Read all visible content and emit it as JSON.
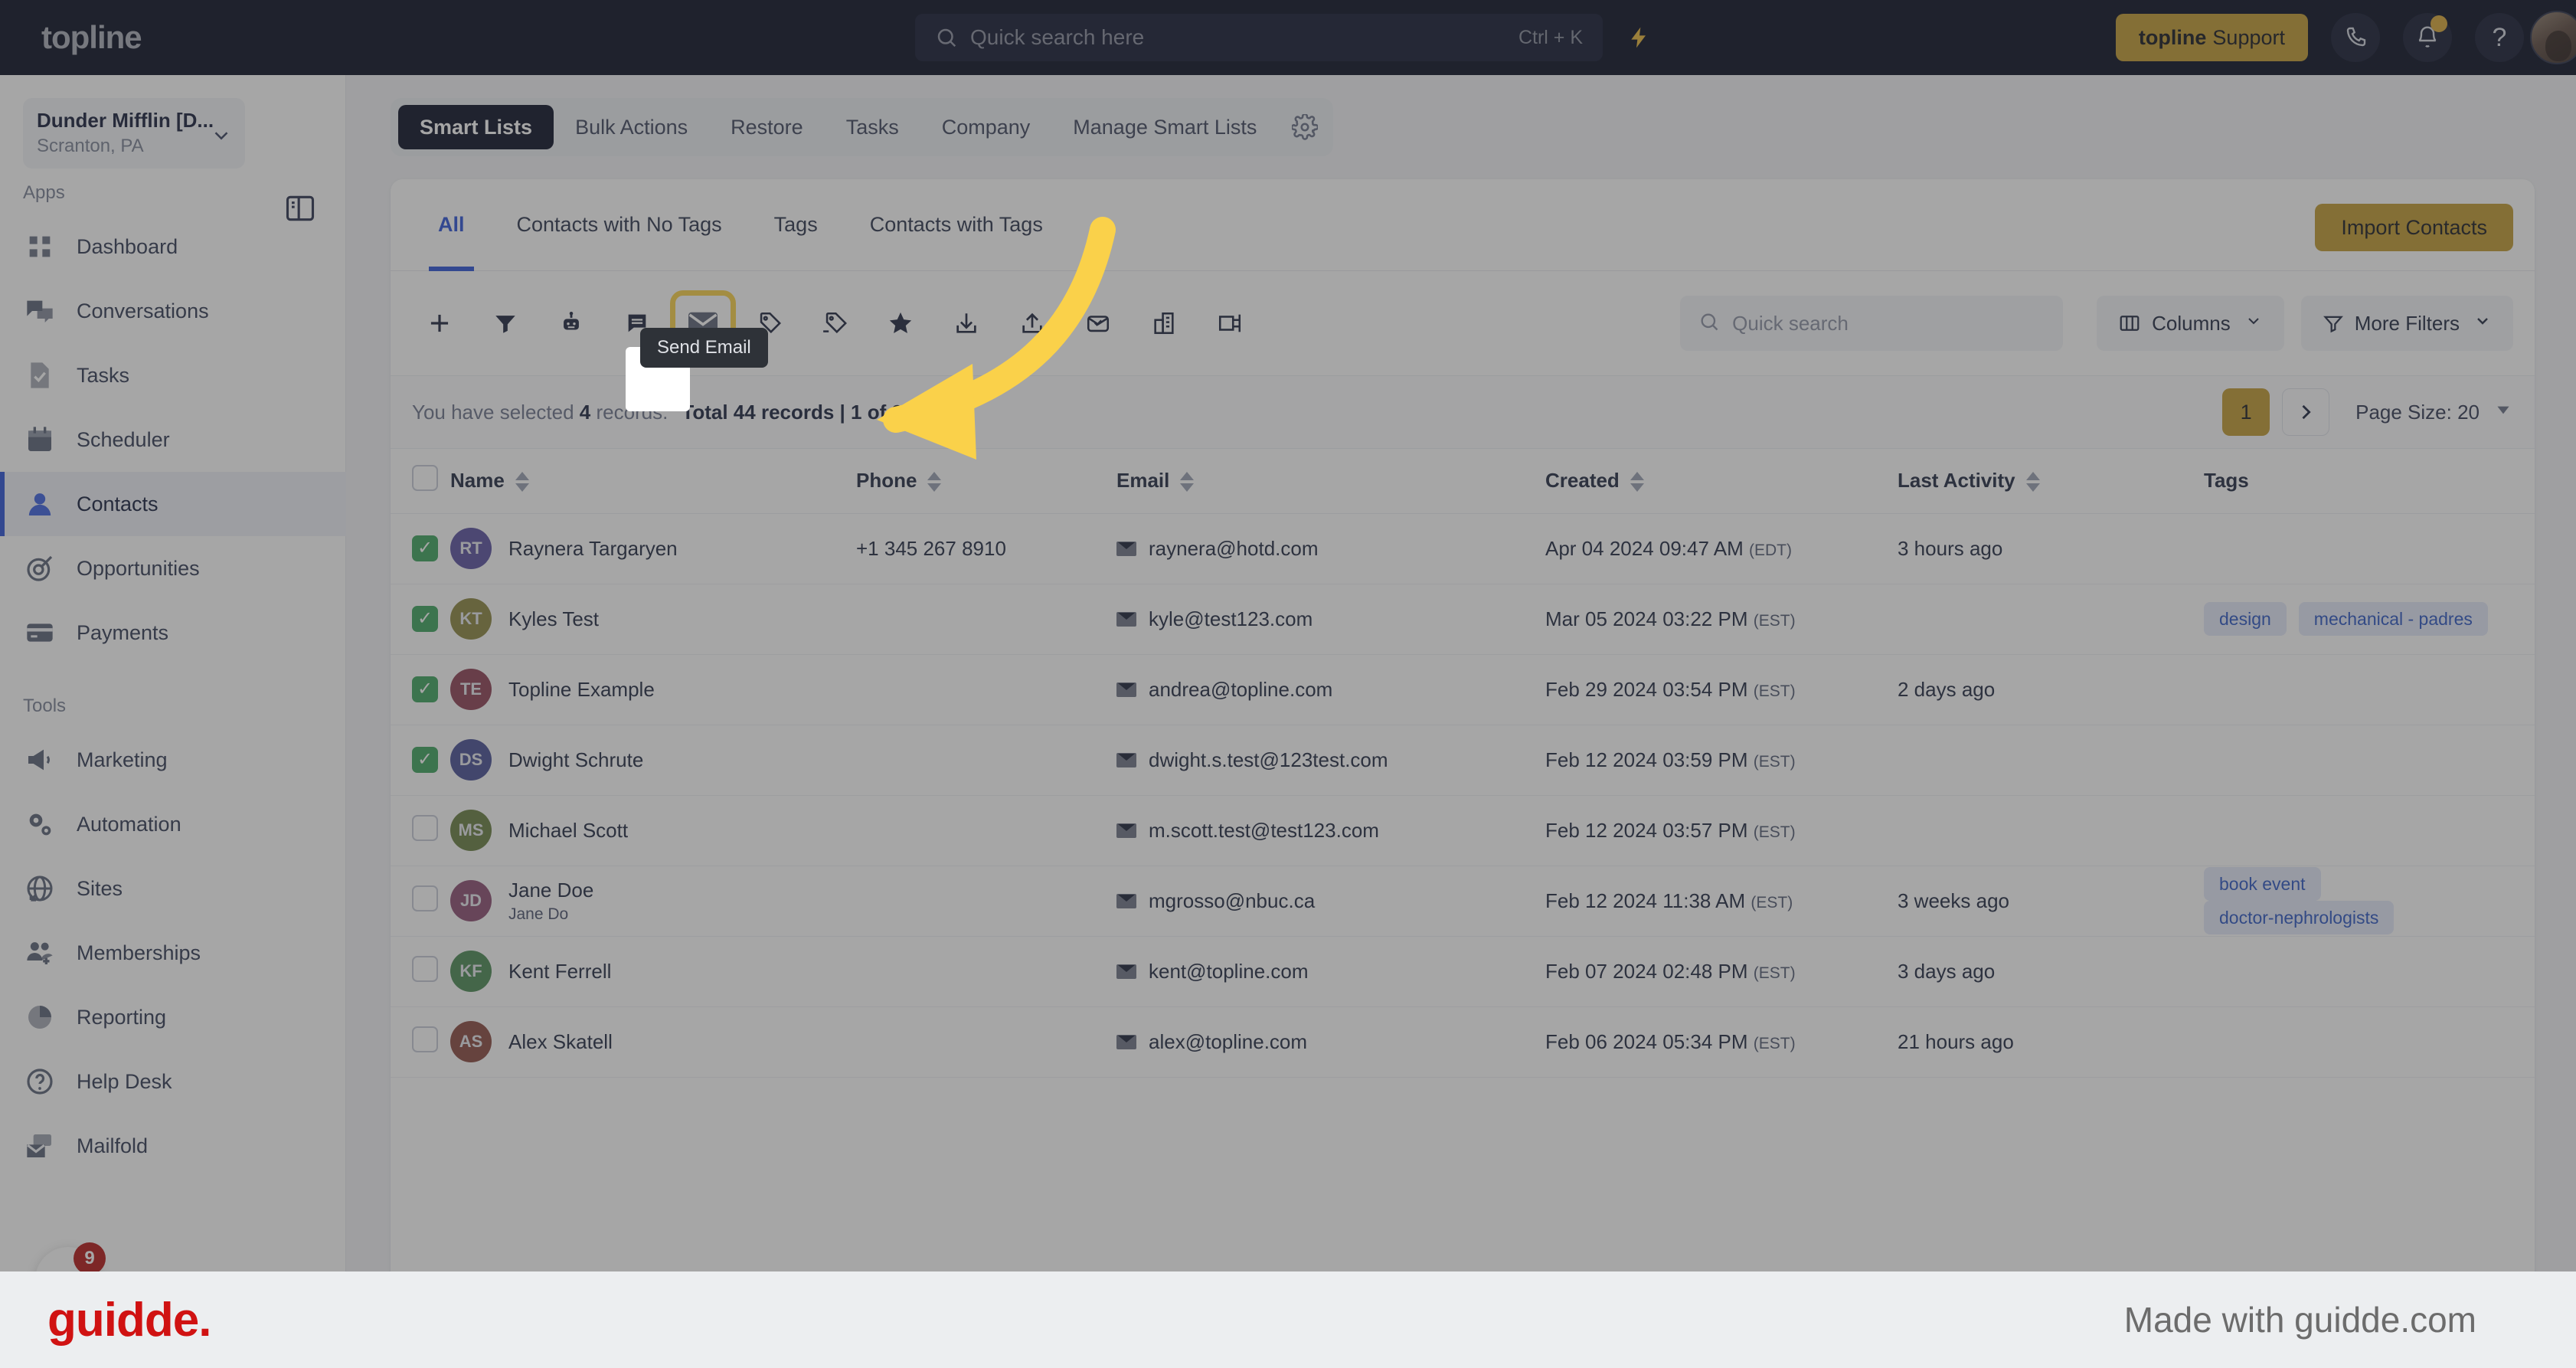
{
  "header": {
    "brand": "topline",
    "search_placeholder": "Quick search here",
    "search_shortcut": "Ctrl + K",
    "support_brand": "topline",
    "support_label": "Support",
    "icons": {
      "bolt": "⚡",
      "phone": "phone",
      "bell": "bell",
      "help": "?"
    }
  },
  "sidebar": {
    "location_name": "Dunder Mifflin [D...",
    "location_sub": "Scranton, PA",
    "sections": [
      {
        "label": "Apps",
        "items": [
          {
            "label": "Dashboard",
            "icon": "dashboard-icon",
            "active": false
          },
          {
            "label": "Conversations",
            "icon": "conversations-icon",
            "active": false
          },
          {
            "label": "Tasks",
            "icon": "tasks-icon",
            "active": false
          },
          {
            "label": "Scheduler",
            "icon": "scheduler-icon",
            "active": false
          },
          {
            "label": "Contacts",
            "icon": "contacts-icon",
            "active": true
          },
          {
            "label": "Opportunities",
            "icon": "opportunities-icon",
            "active": false
          },
          {
            "label": "Payments",
            "icon": "payments-icon",
            "active": false
          }
        ]
      },
      {
        "label": "Tools",
        "items": [
          {
            "label": "Marketing",
            "icon": "marketing-icon",
            "active": false
          },
          {
            "label": "Automation",
            "icon": "automation-icon",
            "active": false
          },
          {
            "label": "Sites",
            "icon": "sites-icon",
            "active": false
          },
          {
            "label": "Memberships",
            "icon": "memberships-icon",
            "active": false
          },
          {
            "label": "Reporting",
            "icon": "reporting-icon",
            "active": false
          },
          {
            "label": "Help Desk",
            "icon": "helpdesk-icon",
            "active": false
          },
          {
            "label": "Mailfold",
            "icon": "mailfold-icon",
            "active": false
          }
        ]
      }
    ],
    "fab_badge": "9"
  },
  "smartlists": {
    "items": [
      "Smart Lists",
      "Bulk Actions",
      "Restore",
      "Tasks",
      "Company",
      "Manage Smart Lists"
    ],
    "active": "Smart Lists"
  },
  "tabs": {
    "items": [
      "All",
      "Contacts with No Tags",
      "Tags",
      "Contacts with Tags"
    ],
    "active": "All",
    "import_label": "Import Contacts"
  },
  "toolbar": {
    "icons": [
      "add-icon",
      "filter-icon",
      "bot-icon",
      "sms-icon",
      "email-icon",
      "add-tag-icon",
      "remove-tag-icon",
      "star-icon",
      "download-icon",
      "upload-icon",
      "mail-check-icon",
      "business-icon",
      "merge-icon"
    ],
    "highlighted_icon": "email-icon",
    "tooltip": "Send Email",
    "search_placeholder": "Quick search",
    "columns_label": "Columns",
    "more_filters_label": "More Filters"
  },
  "meta": {
    "selected_prefix": "You have selected",
    "selected_count": "4",
    "selected_suffix": "records.",
    "total": "Total 44 records | 1 of 3 Pages",
    "page_current": "1",
    "page_size_label": "Page Size: 20"
  },
  "table": {
    "columns": [
      "Name",
      "Phone",
      "Email",
      "Created",
      "Last Activity",
      "Tags"
    ],
    "rows": [
      {
        "selected": true,
        "initials": "RT",
        "color": "#5c52a0",
        "name": "Raynera Targaryen",
        "sub": "",
        "phone": "+1 345 267 8910",
        "email": "raynera@hotd.com",
        "created": "Apr 04 2024 09:47 AM",
        "tz": "(EDT)",
        "activity": "3 hours ago",
        "tags": []
      },
      {
        "selected": true,
        "initials": "KT",
        "color": "#8d8743",
        "name": "Kyles Test",
        "sub": "",
        "phone": "",
        "email": "kyle@test123.com",
        "created": "Mar 05 2024 03:22 PM",
        "tz": "(EST)",
        "activity": "",
        "tags": [
          "design",
          "mechanical - padres"
        ]
      },
      {
        "selected": true,
        "initials": "TE",
        "color": "#8e4257",
        "name": "Topline Example",
        "sub": "",
        "phone": "",
        "email": "andrea@topline.com",
        "created": "Feb 29 2024 03:54 PM",
        "tz": "(EST)",
        "activity": "2 days ago",
        "tags": []
      },
      {
        "selected": true,
        "initials": "DS",
        "color": "#4a5196",
        "name": "Dwight Schrute",
        "sub": "",
        "phone": "",
        "email": "dwight.s.test@123test.com",
        "created": "Feb 12 2024 03:59 PM",
        "tz": "(EST)",
        "activity": "",
        "tags": []
      },
      {
        "selected": false,
        "initials": "MS",
        "color": "#6b8044",
        "name": "Michael Scott",
        "sub": "",
        "phone": "",
        "email": "m.scott.test@test123.com",
        "created": "Feb 12 2024 03:57 PM",
        "tz": "(EST)",
        "activity": "",
        "tags": []
      },
      {
        "selected": false,
        "initials": "JD",
        "color": "#8d4f74",
        "name": "Jane Doe",
        "sub": "Jane Do",
        "phone": "",
        "email": "mgrosso@nbuc.ca",
        "created": "Feb 12 2024 11:38 AM",
        "tz": "(EST)",
        "activity": "3 weeks ago",
        "tags": [
          "book event",
          "doctor-nephrologists"
        ]
      },
      {
        "selected": false,
        "initials": "KF",
        "color": "#4e8a56",
        "name": "Kent Ferrell",
        "sub": "",
        "phone": "",
        "email": "kent@topline.com",
        "created": "Feb 07 2024 02:48 PM",
        "tz": "(EST)",
        "activity": "3 days ago",
        "tags": []
      },
      {
        "selected": false,
        "initials": "AS",
        "color": "#8a4b42",
        "name": "Alex Skatell",
        "sub": "",
        "phone": "",
        "email": "alex@topline.com",
        "created": "Feb 06 2024 05:34 PM",
        "tz": "(EST)",
        "activity": "21 hours ago",
        "tags": []
      }
    ]
  },
  "footer": {
    "logo": "guidde.",
    "made_with": "Made with guidde.com"
  },
  "colors": {
    "accent_gold": "#c29b34",
    "accent_blue": "#2f54d8",
    "dark_navy": "#0a0f24",
    "highlight_yellow": "#fad14a"
  }
}
